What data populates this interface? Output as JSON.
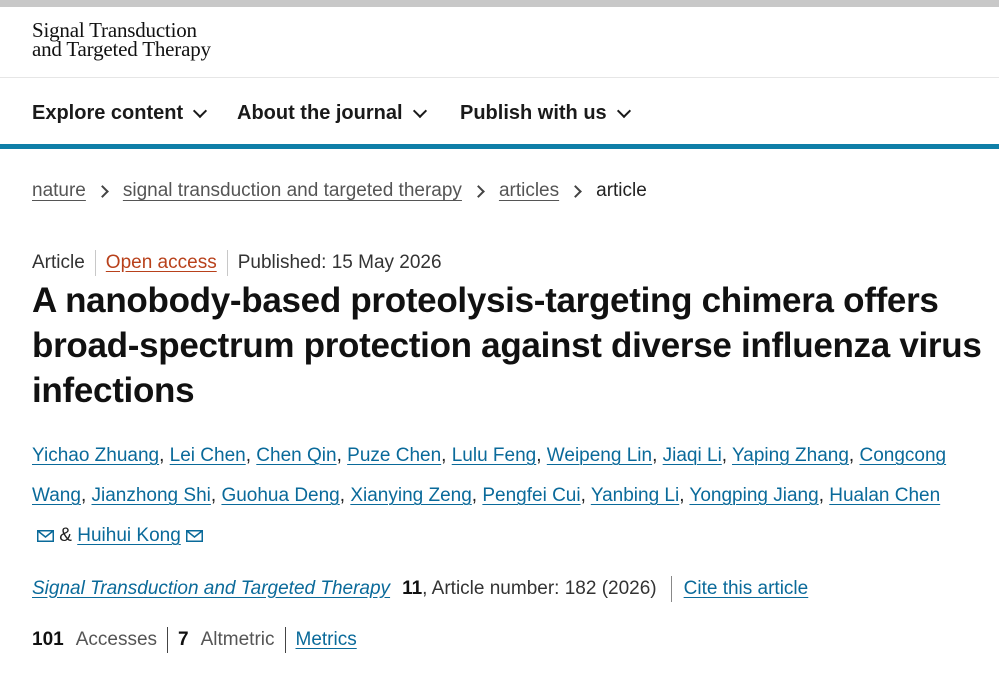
{
  "header": {
    "logo_line1": "Signal Transduction",
    "logo_line2": "and Targeted Therapy"
  },
  "nav": {
    "items": [
      {
        "label": "Explore content"
      },
      {
        "label": "About the journal"
      },
      {
        "label": "Publish with us"
      }
    ]
  },
  "breadcrumb": {
    "items": [
      "nature",
      "signal transduction and targeted therapy",
      "articles"
    ],
    "current": "article"
  },
  "article": {
    "type": "Article",
    "access": "Open access",
    "published": "Published: 15 May 2026",
    "title": "A nanobody-based proteolysis-targeting chimera offers broad-spectrum protection against diverse influenza virus infections",
    "authors": [
      "Yichao Zhuang",
      "Lei Chen",
      "Chen Qin",
      "Puze Chen",
      "Lulu Feng",
      "Weipeng Lin",
      "Jiaqi Li",
      "Yaping Zhang",
      "Congcong Wang",
      "Jianzhong Shi",
      "Guohua Deng",
      "Xianying Zeng",
      "Pengfei Cui",
      "Yanbing Li",
      "Yongping Jiang",
      "Hualan Chen",
      "Huihui Kong"
    ],
    "author_joiner": "&"
  },
  "citation": {
    "journal": "Signal Transduction and Targeted Therapy",
    "volume": "11",
    "article_number": ", Article number: 182 (2026)",
    "cite_label": "Cite this article"
  },
  "metrics": {
    "accesses_count": "101",
    "accesses_label": "Accesses",
    "altmetric_count": "7",
    "altmetric_label": "Altmetric",
    "metrics_link": "Metrics"
  },
  "colors": {
    "accent": "#0f7fa8",
    "link": "#0a6a9a",
    "open_access": "#b8411b"
  },
  "icons": [
    "chevron-down-icon",
    "chevron-right-icon",
    "mail-icon"
  ]
}
